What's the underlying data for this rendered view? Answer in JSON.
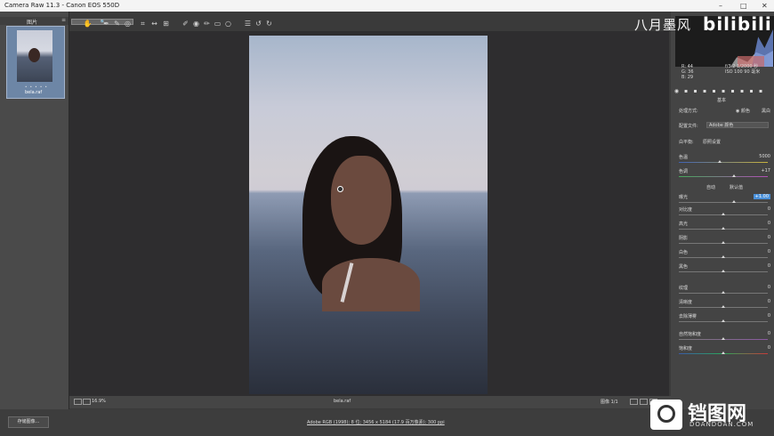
{
  "window": {
    "title": "Camera Raw 11.3  -  Canon EOS 550D",
    "minimize": "–",
    "maximize": "□",
    "close": "✕"
  },
  "filmstrip": {
    "header": "图片",
    "file": "bela.raf",
    "stars": "• • • • •",
    "menu_icon": "≡"
  },
  "toolbar": {
    "icons": [
      "zoom-icon",
      "hand-icon",
      "white-balance-icon",
      "color-sampler-icon",
      "targeted-adjustment-icon",
      "crop-icon",
      "straighten-icon",
      "transform-icon",
      "spot-removal-icon",
      "red-eye-icon",
      "adjustment-brush-icon",
      "graduated-filter-icon",
      "radial-filter-icon",
      "open-preferences-icon",
      "rotate-ccw-icon",
      "rotate-cw-icon"
    ],
    "glyphs": [
      "🔍",
      "✋",
      "✒",
      "✎",
      "◎",
      "⌗",
      "↔",
      "⊞",
      "✐",
      "◉",
      "✏",
      "▭",
      "○",
      "☰",
      "↺",
      "↻"
    ]
  },
  "preview": {
    "filename": "bela.raf",
    "zoom": "16.9%"
  },
  "bottom_bar": {
    "right_text": "图像 1/1"
  },
  "status": {
    "save_button": "存储图像...",
    "workflow_link": "Adobe RGB (1998); 8 位; 3456 x 5184 (17.9 百万像素); 300 ppi"
  },
  "histogram": {
    "rgb": [
      "R:  44",
      "G:  36",
      "B:  29"
    ],
    "camera": [
      "f/3.2   1/2000 秒",
      "ISO 100   90 毫米"
    ]
  },
  "panel": {
    "title": "基本",
    "treatment_label": "处理方式:",
    "treatment_color": "颜色",
    "treatment_bw": "黑白",
    "profile_label": "配置文件:",
    "profile_value": "Adobe 颜色",
    "wb_label": "白平衡:",
    "wb_value": "原照设置",
    "auto": "自动",
    "default": "默认值",
    "sliders": [
      {
        "label": "色温",
        "value": "5000",
        "pos": 0.46,
        "kind": "temp"
      },
      {
        "label": "色调",
        "value": "+17",
        "pos": 0.62,
        "kind": "tint"
      },
      {
        "label": "曝光",
        "value": "+1.00",
        "pos": 0.62,
        "kind": "plain",
        "highlight": true
      },
      {
        "label": "对比度",
        "value": "0",
        "pos": 0.5,
        "kind": "plain"
      },
      {
        "label": "高光",
        "value": "0",
        "pos": 0.5,
        "kind": "plain"
      },
      {
        "label": "阴影",
        "value": "0",
        "pos": 0.5,
        "kind": "plain"
      },
      {
        "label": "白色",
        "value": "0",
        "pos": 0.5,
        "kind": "plain"
      },
      {
        "label": "黑色",
        "value": "0",
        "pos": 0.5,
        "kind": "plain"
      },
      {
        "label": "纹理",
        "value": "0",
        "pos": 0.5,
        "kind": "plain"
      },
      {
        "label": "清晰度",
        "value": "0",
        "pos": 0.5,
        "kind": "plain"
      },
      {
        "label": "去除薄雾",
        "value": "0",
        "pos": 0.5,
        "kind": "plain"
      },
      {
        "label": "自然饱和度",
        "value": "0",
        "pos": 0.5,
        "kind": "vib"
      },
      {
        "label": "饱和度",
        "value": "0",
        "pos": 0.5,
        "kind": "sat"
      }
    ]
  },
  "watermarks": {
    "top_cn": "八月墨风",
    "top_en": "bilibili",
    "bottom_cn": "铛图网",
    "bottom_en": "DOANDOAN.COM"
  },
  "colors": {
    "accent": "#4a90d9",
    "panel_bg": "#444444",
    "canvas_bg": "#2e2d2f"
  }
}
